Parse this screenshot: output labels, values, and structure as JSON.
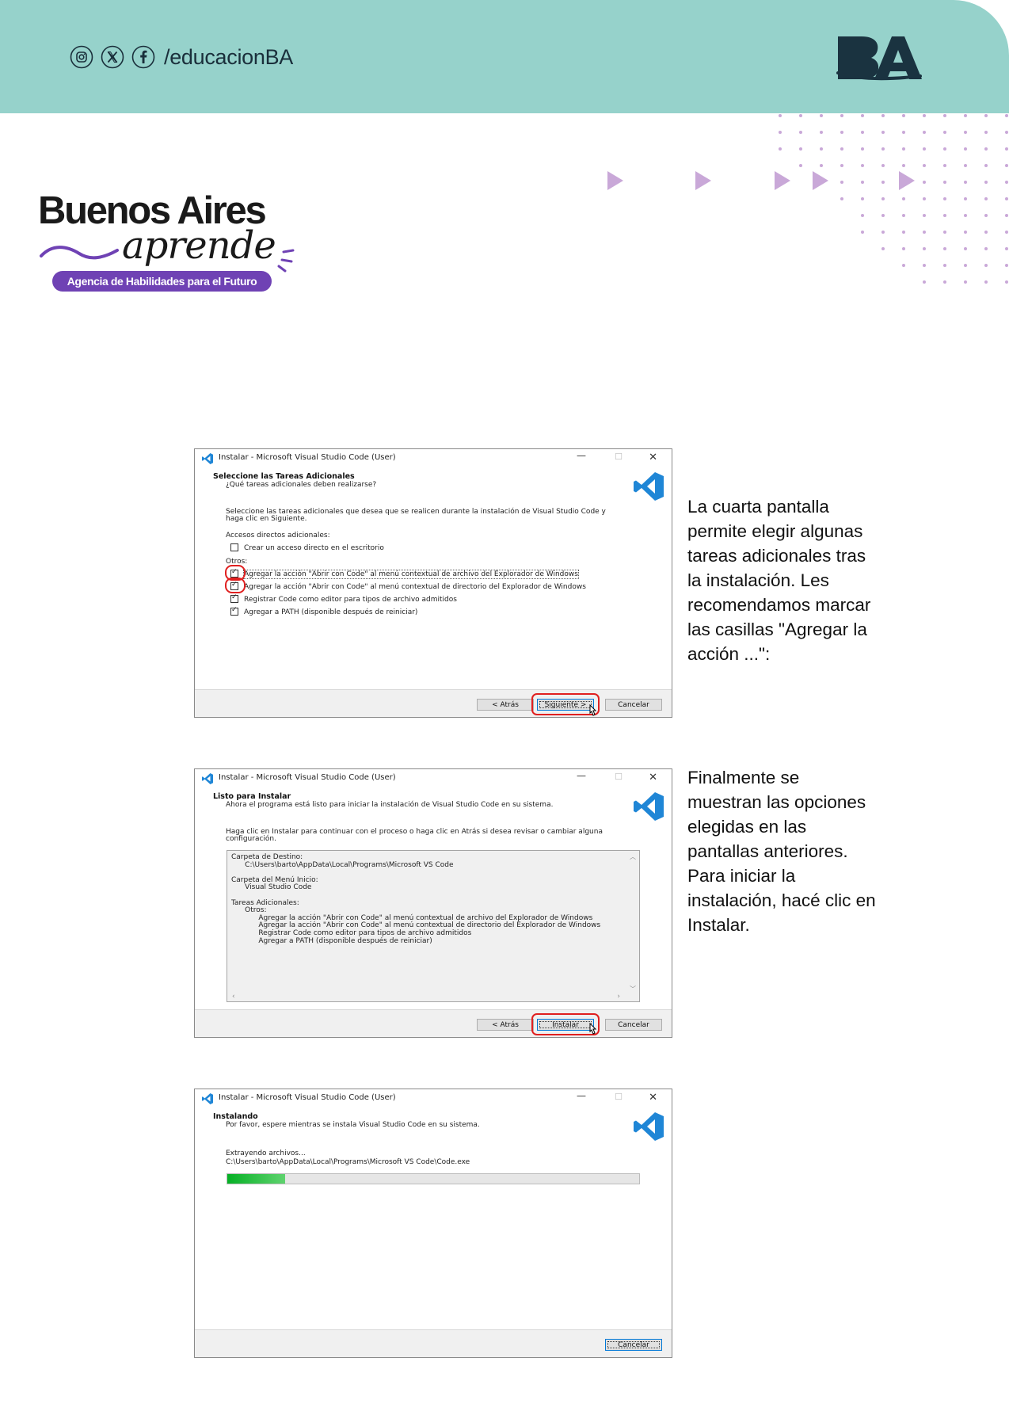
{
  "header": {
    "social_icons": [
      "instagram-icon",
      "x-icon",
      "facebook-icon"
    ],
    "handle": "/educacionBA",
    "logo_text": "BA",
    "colors": {
      "band": "#96d2cb",
      "logo": "#1a3340"
    }
  },
  "brand": {
    "title": "Buenos Aires",
    "script": "aprende",
    "subtitle": "Agencia de Habilidades para el Futuro",
    "accent": "#6f42b4"
  },
  "decor": {
    "arrow_color": "#c9a8d8",
    "dot_color": "#c9a8d8"
  },
  "dialog_title": "Instalar - Microsoft Visual Studio Code (User)",
  "dialogs": [
    {
      "heading": "Seleccione las Tareas Adicionales",
      "subheading": "¿Qué tareas adicionales deben realizarse?",
      "intro_line1": "Seleccione las tareas adicionales que desea que se realicen durante la instalación de Visual Studio Code y",
      "intro_line2": "haga clic en Siguiente.",
      "group1": "Accesos directos adicionales:",
      "opt_desktop": "Crear un acceso directo en el escritorio",
      "group2": "Otros:",
      "opt_file": "Agregar la acción \"Abrir con Code\" al menú contextual de archivo del Explorador de Windows",
      "opt_dir": "Agregar la acción \"Abrir con Code\" al menú contextual de directorio del Explorador de Windows",
      "opt_editor": "Registrar Code como editor para tipos de archivo admitidos",
      "opt_path": "Agregar a PATH (disponible después de reiniciar)",
      "btn_back": "< Atrás",
      "btn_next": "Siguiente >",
      "btn_cancel": "Cancelar"
    },
    {
      "heading": "Listo para Instalar",
      "subheading": "Ahora el programa está listo para iniciar la instalación de Visual Studio Code en su sistema.",
      "intro_line1": "Haga clic en Instalar para continuar con el proceso o haga clic en Atrás si desea revisar o cambiar alguna",
      "intro_line2": "configuración.",
      "memo": [
        "Carpeta de Destino:",
        "      C:\\Users\\barto\\AppData\\Local\\Programs\\Microsoft VS Code",
        "",
        "Carpeta del Menú Inicio:",
        "      Visual Studio Code",
        "",
        "Tareas Adicionales:",
        "      Otros:",
        "            Agregar la acción \"Abrir con Code\" al menú contextual de archivo del Explorador de Windows",
        "            Agregar la acción \"Abrir con Code\" al menú contextual de directorio del Explorador de Windows",
        "            Registrar Code como editor para tipos de archivo admitidos",
        "            Agregar a PATH (disponible después de reiniciar)"
      ],
      "btn_back": "< Atrás",
      "btn_install": "Instalar",
      "btn_cancel": "Cancelar"
    },
    {
      "heading": "Instalando",
      "subheading": "Por favor, espere mientras se instala Visual Studio Code en su sistema.",
      "status": "Extrayendo archivos...",
      "path": "C:\\Users\\barto\\AppData\\Local\\Programs\\Microsoft VS Code\\Code.exe",
      "progress": 0.14,
      "btn_cancel": "Cancelar"
    }
  ],
  "captions": [
    [
      "La cuarta pantalla",
      "permite elegir algunas",
      "tareas adicionales tras",
      "la instalación. Les",
      "recomendamos marcar",
      "las casillas \"Agregar la",
      "acción ...\":"
    ],
    [
      "Finalmente se",
      "muestran las opciones",
      "elegidas en las",
      "pantallas anteriores.",
      "Para iniciar la",
      "instalación, hacé clic en",
      "Instalar."
    ]
  ]
}
